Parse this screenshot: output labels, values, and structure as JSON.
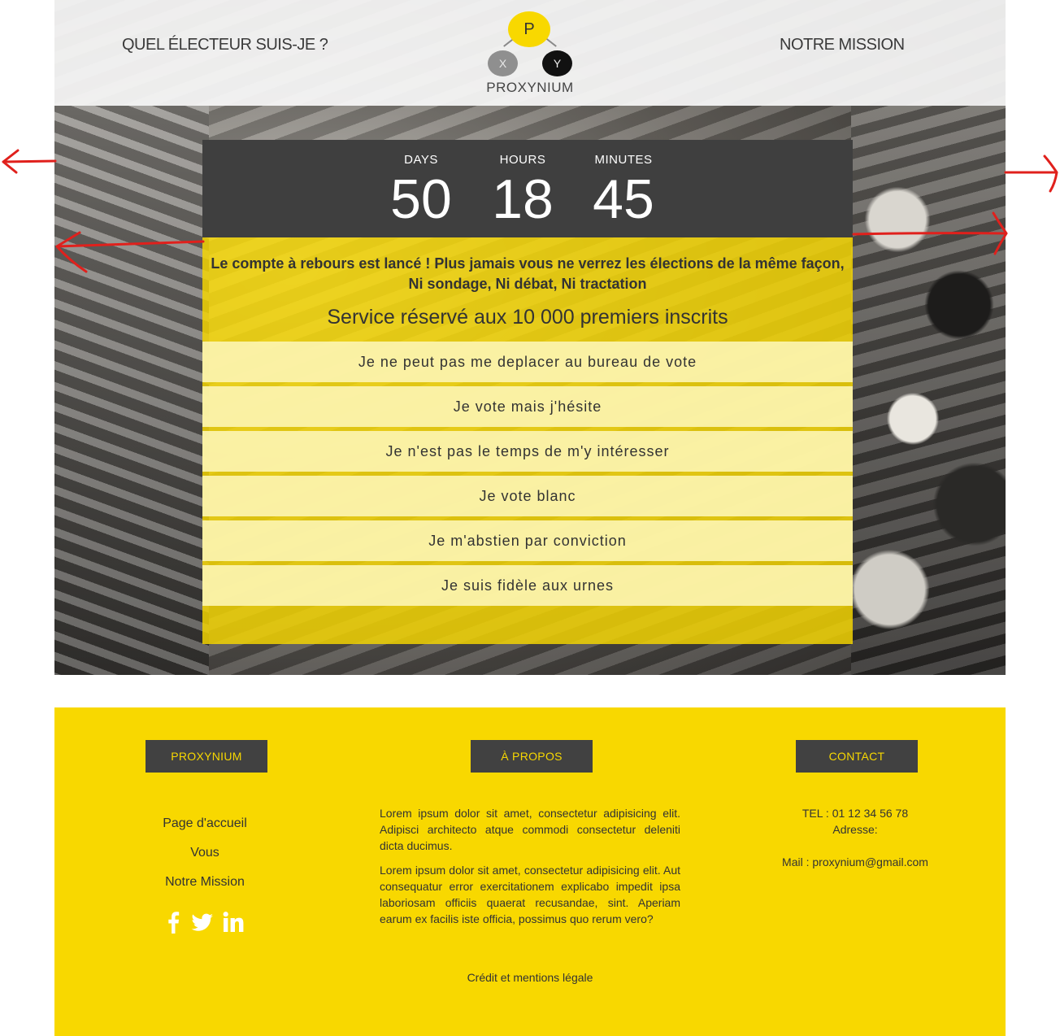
{
  "header": {
    "nav_left": "QUEL ÉLECTEUR SUIS-JE ?",
    "nav_right": "NOTRE MISSION",
    "logo": {
      "p": "P",
      "x": "X",
      "y": "Y",
      "name": "PROXYNIUM"
    }
  },
  "countdown": {
    "days_label": "DAYS",
    "days": "50",
    "hours_label": "HOURS",
    "hours": "18",
    "minutes_label": "MINUTES",
    "minutes": "45"
  },
  "main": {
    "tagline_1": "Le compte à rebours est lancé ! Plus jamais vous ne verrez les élections de la même façon,",
    "tagline_2": "Ni sondage, Ni débat, Ni tractation",
    "service": "Service réservé aux 10 000 premiers inscrits",
    "options": [
      "Je ne peut pas me deplacer au bureau de vote",
      "Je vote mais j'hésite",
      "Je n'est pas le temps de m'y intéresser",
      "Je vote blanc",
      "Je m'abstien par conviction",
      "Je suis fidèle aux urnes"
    ]
  },
  "footer": {
    "btn_proxynium": "PROXYNIUM",
    "btn_apropos": "À PROPOS",
    "btn_contact": "CONTACT",
    "links": [
      "Page d'accueil",
      "Vous",
      "Notre Mission"
    ],
    "social_icons": [
      "facebook-icon",
      "twitter-icon",
      "linkedin-icon"
    ],
    "about_p1": "Lorem ipsum dolor sit amet, consectetur adipisicing elit. Adipisci architecto atque commodi consectetur deleniti dicta ducimus.",
    "about_p2": "Lorem ipsum dolor sit amet, consectetur adipisicing elit. Aut consequatur error exercitationem explicabo impedit ipsa laboriosam officiis quaerat recusandae, sint. Aperiam earum ex facilis iste officia, possimus quo rerum vero?",
    "tel": "TEL : 01 12 34 56 78",
    "adresse": "Adresse:",
    "mail": "Mail : proxynium@gmail.com",
    "credit": "Crédit et mentions légale"
  },
  "colors": {
    "accent": "#f8d800",
    "dark": "#3f3f3f",
    "annotation": "#e0201c"
  }
}
